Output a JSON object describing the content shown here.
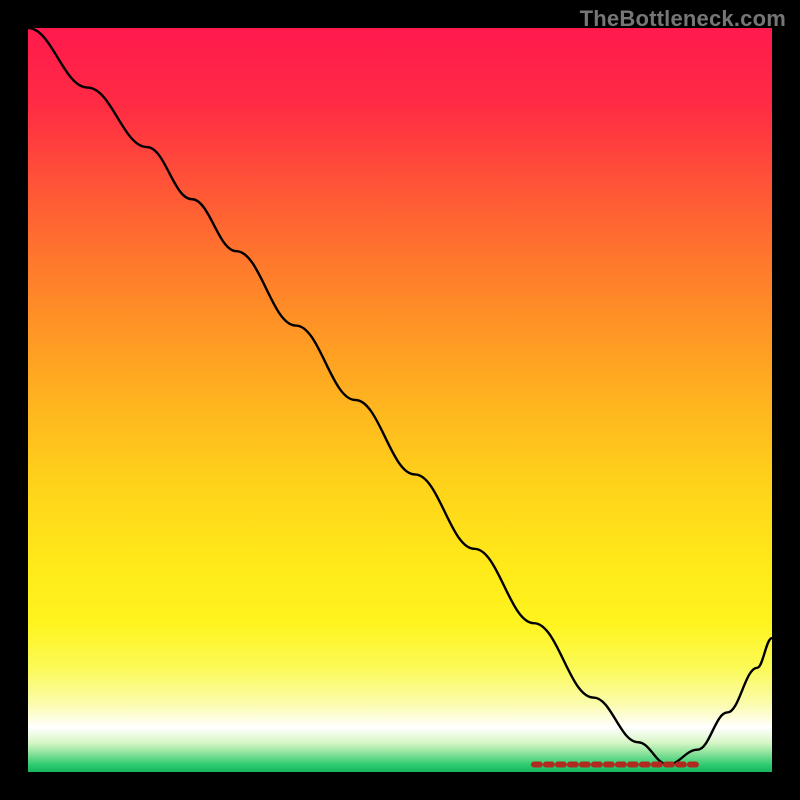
{
  "watermark": "TheBottleneck.com",
  "chart_data": {
    "type": "line",
    "title": "",
    "xlabel": "",
    "ylabel": "",
    "x_range": [
      0,
      100
    ],
    "y_range": [
      0,
      100
    ],
    "notes": "Single black curve plotted over a vertical color gradient (red→green). Axes are black with no tick labels. Values estimated from pixel positions; minimum of curve sits near x≈86, y≈1 (green band). Red dashed segment marks the bottleneck-optimal region along the bottom edge.",
    "series": [
      {
        "name": "bottleneck-curve",
        "x": [
          0,
          8,
          16,
          22,
          28,
          36,
          44,
          52,
          60,
          68,
          76,
          82,
          86,
          90,
          94,
          98,
          100
        ],
        "y": [
          100,
          92,
          84,
          77,
          70,
          60,
          50,
          40,
          30,
          20,
          10,
          4,
          1,
          3,
          8,
          14,
          18
        ]
      }
    ],
    "optimal_marker": {
      "x_start": 68,
      "x_end": 90,
      "y": 1,
      "color": "#b02a1f"
    },
    "gradient_stops": [
      {
        "pos": 0.0,
        "color": "#ff1a4d"
      },
      {
        "pos": 0.72,
        "color": "#ffe91a"
      },
      {
        "pos": 0.94,
        "color": "#ffffff"
      },
      {
        "pos": 1.0,
        "color": "#18b45e"
      }
    ]
  }
}
